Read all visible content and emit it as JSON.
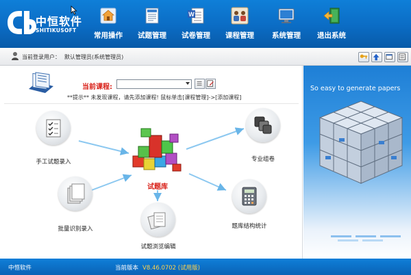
{
  "app": {
    "brand": "中恒软件",
    "brand_sub": "SHITIKUSOFT"
  },
  "nav": [
    {
      "label": "常用操作",
      "icon": "home-icon"
    },
    {
      "label": "试题管理",
      "icon": "document-list-icon"
    },
    {
      "label": "试卷管理",
      "icon": "word-document-icon"
    },
    {
      "label": "课程管理",
      "icon": "people-group-icon"
    },
    {
      "label": "系统管理",
      "icon": "computer-monitor-icon"
    },
    {
      "label": "退出系统",
      "icon": "exit-door-icon"
    }
  ],
  "login": {
    "label": "当前登录用户：",
    "user": "默认管理员(系统管理员)"
  },
  "toolbar_icons": [
    "key-icon",
    "up-arrow-icon",
    "window-icon",
    "info-icon"
  ],
  "course": {
    "label": "当前课程:",
    "value": "",
    "hint": "**提示** 未发现课程，请先添加课程! 鼠标单击[课程管理]->[添加课程]"
  },
  "features": {
    "manual_entry": "手工试题录入",
    "batch_import": "批量识别录入",
    "browse_edit": "试题浏览编辑",
    "structure_stats": "题库结构统计",
    "pro_assemble": "专业组卷",
    "bank": "试题库"
  },
  "promo": {
    "tagline": "So easy to generate papers"
  },
  "status": {
    "company": "中恒软件",
    "version_label": "当前版本",
    "version": "V8.46.0702 (试用版)"
  },
  "colors": {
    "header_blue": "#0b6cc4",
    "accent_red": "#d9221a",
    "version_yellow": "#ffd34d"
  }
}
